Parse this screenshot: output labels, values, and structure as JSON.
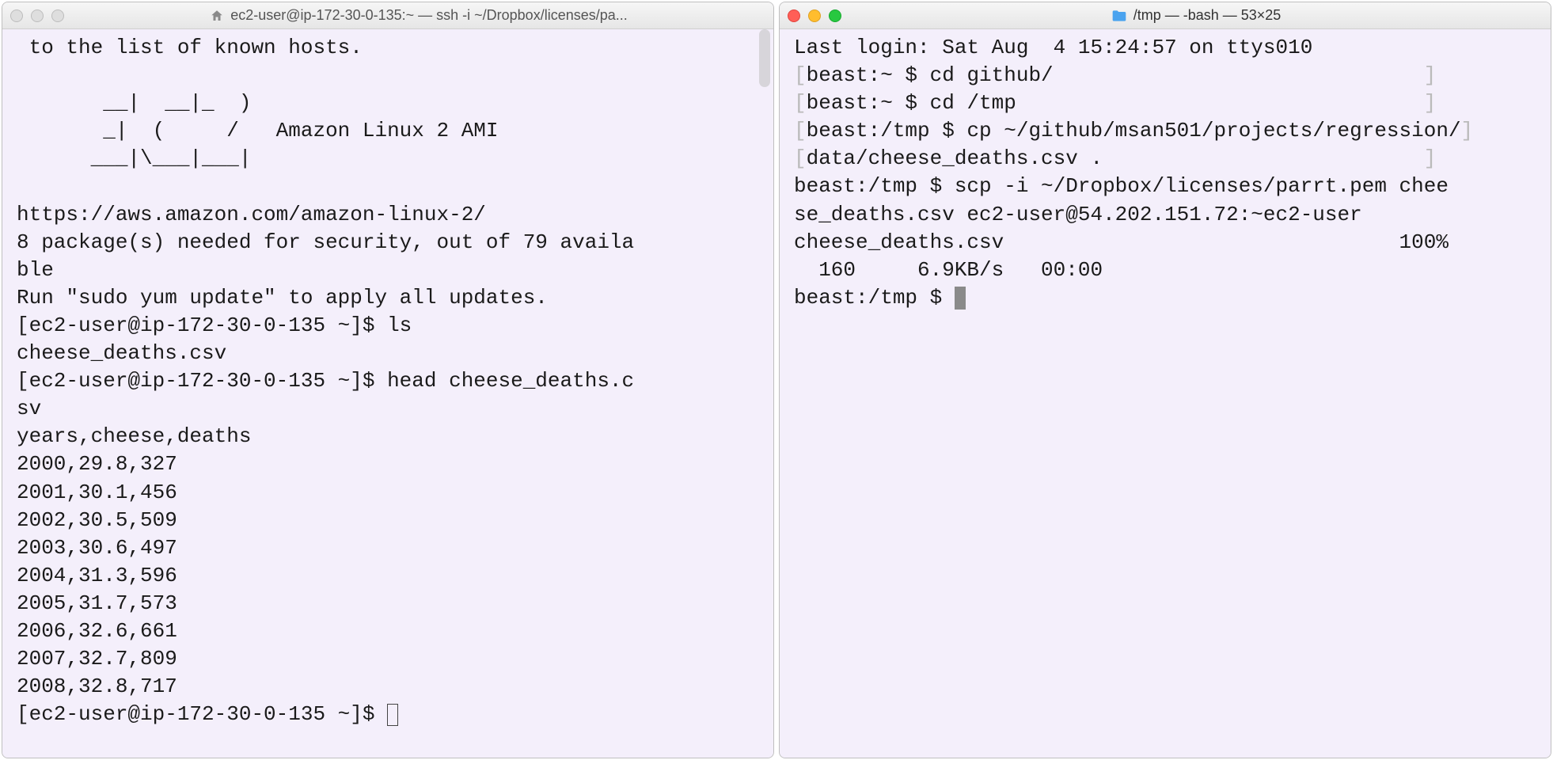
{
  "left": {
    "active": false,
    "title": "ec2-user@ip-172-30-0-135:~ — ssh -i ~/Dropbox/licenses/pa...",
    "scroll_thumb": {
      "top_pct": 0,
      "height_pct": 8
    },
    "lines": [
      " to the list of known hosts.",
      "",
      "       __|  __|_  )",
      "       _|  (     /   Amazon Linux 2 AMI",
      "      ___|\\___|___|",
      "",
      "https://aws.amazon.com/amazon-linux-2/",
      "8 package(s) needed for security, out of 79 availa",
      "ble",
      "Run \"sudo yum update\" to apply all updates.",
      "[ec2-user@ip-172-30-0-135 ~]$ ls",
      "cheese_deaths.csv",
      "[ec2-user@ip-172-30-0-135 ~]$ head cheese_deaths.c",
      "sv",
      "years,cheese,deaths",
      "2000,29.8,327",
      "2001,30.1,456",
      "2002,30.5,509",
      "2003,30.6,497",
      "2004,31.3,596",
      "2005,31.7,573",
      "2006,32.6,661",
      "2007,32.7,809",
      "2008,32.8,717"
    ],
    "prompt_tail": "[ec2-user@ip-172-30-0-135 ~]$ "
  },
  "right": {
    "active": true,
    "title": "/tmp — -bash — 53×25",
    "scroll_thumb": {
      "top_pct": 0,
      "height_pct": 100
    },
    "lines_raw": [
      {
        "pre": "",
        "text": "Last login: Sat Aug  4 15:24:57 on ttys010",
        "post": ""
      },
      {
        "pre": "[",
        "text": "beast:~ $ cd github/",
        "post": "                              ]"
      },
      {
        "pre": "[",
        "text": "beast:~ $ cd /tmp",
        "post": "                                 ]"
      },
      {
        "pre": "[",
        "text": "beast:/tmp $ cp ~/github/msan501/projects/regression/",
        "post": "]"
      },
      {
        "pre": "[",
        "text": "data/cheese_deaths.csv .",
        "post": "                          ]"
      },
      {
        "pre": "",
        "text": "beast:/tmp $ scp -i ~/Dropbox/licenses/parrt.pem chee",
        "post": ""
      },
      {
        "pre": "",
        "text": "se_deaths.csv ec2-user@54.202.151.72:~ec2-user",
        "post": ""
      },
      {
        "pre": "",
        "text": "cheese_deaths.csv                                100%",
        "post": ""
      },
      {
        "pre": "",
        "text": "  160     6.9KB/s   00:00",
        "post": ""
      }
    ],
    "prompt_tail": "beast:/tmp $ "
  }
}
